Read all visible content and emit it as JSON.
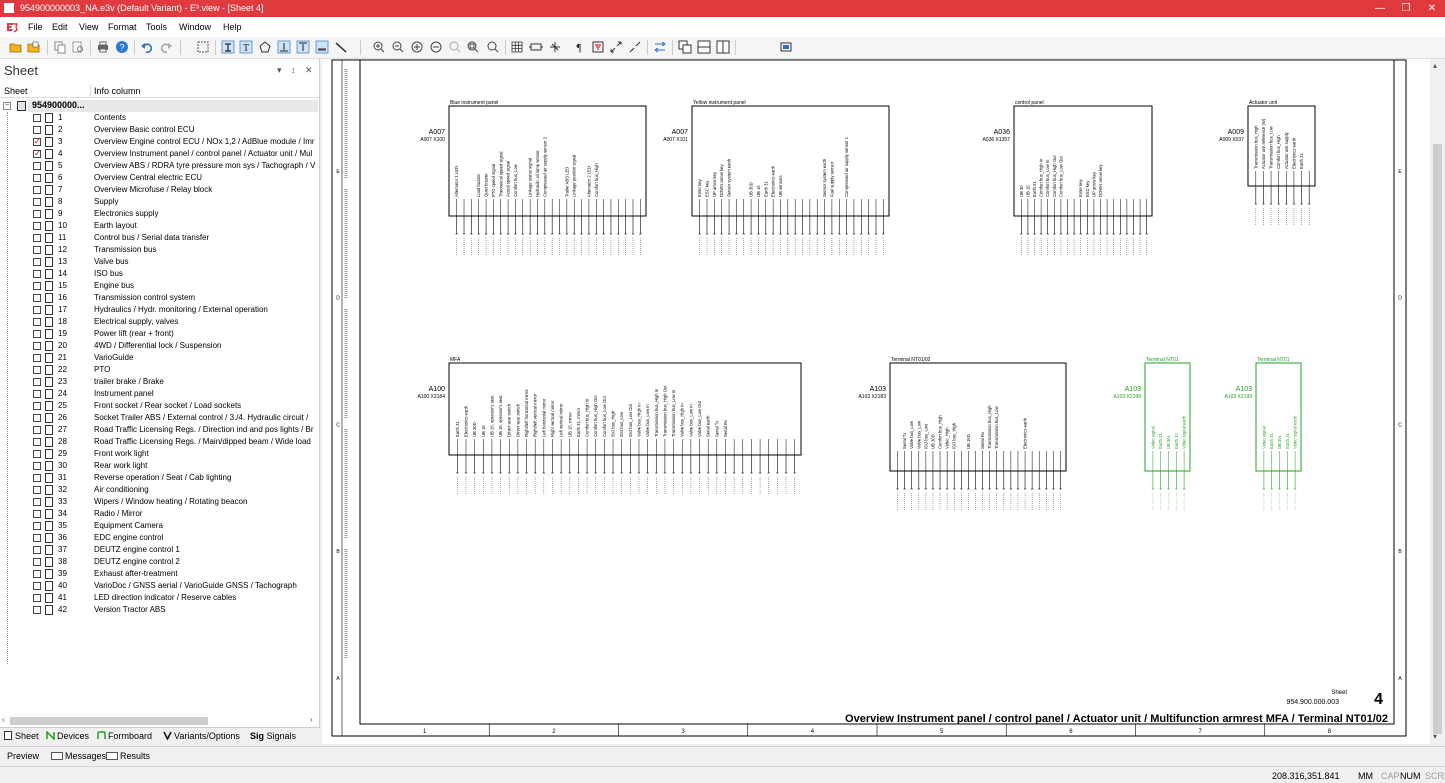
{
  "window": {
    "title": "954900000003_NA.e3v (Default Variant) - E³.view - [Sheet 4]",
    "min_icon": "minimize-icon",
    "max_icon": "restore-icon",
    "close_icon": "close-icon",
    "minimize_glyph": "—",
    "restore_glyph": "❐",
    "close_glyph": "✕"
  },
  "menu": [
    "File",
    "Edit",
    "View",
    "Format",
    "Tools",
    "Window",
    "Help"
  ],
  "sidebar": {
    "panel_title": "Sheet",
    "panel_dropdown_glyph": "▾",
    "panel_pin_glyph": "↕",
    "panel_close_glyph": "✕",
    "col_sheet": "Sheet",
    "col_info": "Info column",
    "root_label": "954900000...",
    "expand_glyph": "−",
    "scroll_left_glyph": "‹",
    "scroll_right_glyph": "›",
    "sheets": [
      {
        "num": "1",
        "info": "Contents",
        "checked": false
      },
      {
        "num": "2",
        "info": "Overview Basic control ECU",
        "checked": false
      },
      {
        "num": "3",
        "info": "Overview Engine control ECU / NOx 1,2 / AdBlue module / Imr",
        "checked": true
      },
      {
        "num": "4",
        "info": "Overview Instrument panel / control panel / Actuator unit / Mul",
        "checked": true
      },
      {
        "num": "5",
        "info": "Overview ABS / RDRA tyre pressure mon sys / Tachograph / V",
        "checked": false
      },
      {
        "num": "6",
        "info": "Overview Central electric ECU",
        "checked": false
      },
      {
        "num": "7",
        "info": "Overview Microfuse / Relay block",
        "checked": false
      },
      {
        "num": "8",
        "info": "Supply",
        "checked": false
      },
      {
        "num": "9",
        "info": "Electronics supply",
        "checked": false
      },
      {
        "num": "10",
        "info": "Earth layout",
        "checked": false
      },
      {
        "num": "11",
        "info": "Control bus / Serial data transfer",
        "checked": false
      },
      {
        "num": "12",
        "info": "Transmission bus",
        "checked": false
      },
      {
        "num": "13",
        "info": "Valve bus",
        "checked": false
      },
      {
        "num": "14",
        "info": "ISO bus",
        "checked": false
      },
      {
        "num": "15",
        "info": "Engine bus",
        "checked": false
      },
      {
        "num": "16",
        "info": "Transmission control system",
        "checked": false
      },
      {
        "num": "17",
        "info": "Hydraulics / Hydr. monitoring / External operation",
        "checked": false
      },
      {
        "num": "18",
        "info": "Electrical supply, valves",
        "checked": false
      },
      {
        "num": "19",
        "info": "Power lift (rear + front)",
        "checked": false
      },
      {
        "num": "20",
        "info": "4WD / Differential lock / Suspension",
        "checked": false
      },
      {
        "num": "21",
        "info": "VarioGuide",
        "checked": false
      },
      {
        "num": "22",
        "info": "PTO",
        "checked": false
      },
      {
        "num": "23",
        "info": "trailer brake / Brake",
        "checked": false
      },
      {
        "num": "24",
        "info": "Instrument panel",
        "checked": false
      },
      {
        "num": "25",
        "info": "Front socket / Rear socket / Load sockets",
        "checked": false
      },
      {
        "num": "26",
        "info": "Socket Trailer ABS / External control / 3./4. Hydraulic circuit /",
        "checked": false
      },
      {
        "num": "27",
        "info": "Road Traffic Licensing Regs. / Direction ind and pos lights / Br",
        "checked": false
      },
      {
        "num": "28",
        "info": "Road Traffic Licensing Regs. / Main/dipped beam / Wide load",
        "checked": false
      },
      {
        "num": "29",
        "info": "Front work light",
        "checked": false
      },
      {
        "num": "30",
        "info": "Rear work light",
        "checked": false
      },
      {
        "num": "31",
        "info": "Reverse operation / Seat / Cab lighting",
        "checked": false
      },
      {
        "num": "32",
        "info": "Air conditioning",
        "checked": false
      },
      {
        "num": "33",
        "info": "Wipers / Window heating / Rotating beacon",
        "checked": false
      },
      {
        "num": "34",
        "info": "Radio / Mirror",
        "checked": false
      },
      {
        "num": "35",
        "info": "Equipment Camera",
        "checked": false
      },
      {
        "num": "36",
        "info": "EDC engine control",
        "checked": false
      },
      {
        "num": "37",
        "info": "DEUTZ engine control 1",
        "checked": false
      },
      {
        "num": "38",
        "info": "DEUTZ engine control 2",
        "checked": false
      },
      {
        "num": "39",
        "info": "Exhaust after-treatment",
        "checked": false
      },
      {
        "num": "40",
        "info": "VarioDoc / GNSS aerial / VarioGuide GNSS / Tachograph",
        "checked": false
      },
      {
        "num": "41",
        "info": "LED direction indicator / Reserve cables",
        "checked": false
      },
      {
        "num": "42",
        "info": "Version Tractor ABS",
        "checked": false
      }
    ]
  },
  "bottom_tabs": [
    "Sheet",
    "Devices",
    "Formboard",
    "Variants/Options",
    "Signals"
  ],
  "bottom_tab_icon_text": "Sig",
  "output_tabs": [
    "Preview",
    "Messages",
    "Results"
  ],
  "status": {
    "coords": "208.316,351.841",
    "units": "MM",
    "caps": "CAP",
    "num": "NUM",
    "scrl": "SCRL"
  },
  "colors": {
    "title_red": "#e03a3e",
    "green": "#20a020"
  },
  "drawing": {
    "sheet_title": "Overview Instrument panel / control panel / Actuator unit / Multifunction armrest MFA / Terminal NT01/02",
    "sheet_label": "Sheet",
    "sheet_number_code": "954.900.000.003",
    "sheet_number": "4",
    "columns": [
      "1",
      "2",
      "3",
      "4",
      "5",
      "6",
      "7",
      "8"
    ],
    "rows_left": [
      "E",
      "D",
      "C",
      "B",
      "A"
    ],
    "rows_right": [
      "E",
      "D",
      "C",
      "B",
      "A"
    ],
    "vscroll_up_glyph": "▴",
    "vscroll_down_glyph": "▾",
    "components": [
      {
        "id": "A007",
        "ref": "A007  X100",
        "title": "Blue instrument panel",
        "pins": 26,
        "color": "black",
        "signals": [
          "Alternator 1 LED",
          "",
          "",
          "Load buzzer",
          "Quiet buzzer",
          "PTO speed signal",
          "Theoretical speed signal",
          "Actual speed signal",
          "Comfort bus_Low",
          "",
          "Linkage status signal",
          "Hydraulic oil lamp sensor",
          "Compressed air supply sensor 2",
          "",
          "",
          "Trailer ABS LED",
          "Linkage position signal",
          "",
          "Alternator 2 LED",
          "Comfort bus_High"
        ]
      },
      {
        "id": "A007",
        "ref": "A007  X101",
        "title": "Yellow instrument panel",
        "pins": 26,
        "color": "black",
        "signals": [
          "Enter key",
          "ESC key",
          "UP arrow key",
          "DOWN arrow key",
          "Sensor system earth",
          "",
          "",
          "UB 30D",
          "UB 15",
          "Earth 31",
          "Electronics earth",
          "UB sensors",
          "",
          "",
          "",
          "",
          "",
          "Sensor system earth",
          "Fuel supply sensor",
          "",
          "Compressed air supply sensor 1"
        ]
      },
      {
        "id": "A036",
        "ref": "A036  X1357",
        "title": "control panel",
        "pins": 20,
        "color": "black",
        "signals": [
          "UB 30",
          "UB 15",
          "Earth 31",
          "Comfort bus_High In",
          "Comfort bus_Low In",
          "Comfort bus_High Out",
          "Comfort bus_Low Out",
          "",
          "",
          "Enter key",
          "ESC key",
          "UP arrow key",
          "DOWN arrow key"
        ]
      },
      {
        "id": "A009",
        "ref": "A009  X037",
        "title": "Actuator unit",
        "pins": 8,
        "color": "black",
        "signals": [
          "Transmission bus_High",
          "Actuator unit reference (W)",
          "Transmission bus_Low",
          "Comfort bus_High",
          "Actuator unit supply",
          "Electronics earth",
          "Earth 31"
        ]
      },
      {
        "id": "A100",
        "ref": "A100  X2184",
        "title": "MFA",
        "pins": 40,
        "color": "black",
        "signals": [
          "Earth 31",
          "Electronics earth",
          "UB 30D",
          "UB 15",
          "UB 15, operator's seat",
          "UB 15, operator's seat",
          "Driver seat switch",
          "Driver seat switch",
          "Right/left horizontal mirror",
          "Right/left vertical mirror",
          "Left horizontal mirror",
          "Right vertical mirror",
          "Left vertical mirror",
          "UB 15, mirror",
          "Earth 31, mirror",
          "Comfort bus_High In",
          "Comfort bus_High Out",
          "Comfort bus_Low Out",
          "ISO bus_High",
          "ISO bus_Low",
          "ISO bus_Low Out",
          "Valve bus_High In",
          "Valve bus_Low In",
          "Transmission bus_High In",
          "Transmission bus_High Out",
          "Transmission bus_Low In",
          "Valve bus_High In",
          "Valve bus_Low In",
          "Valve bus_Low Out",
          "Serial earth",
          "Serial Tx",
          "Serial Rx"
        ]
      },
      {
        "id": "A103",
        "ref": "A103  X2183",
        "title": "Terminal NT01/02",
        "pins": 24,
        "color": "black",
        "signals": [
          "",
          "Serial Tx",
          "Valve bus_Low",
          "Valve bus_Low",
          "ISO bus_Low",
          "UB 30D",
          "Comfort bus_High",
          "Video_High",
          "ISO bus_High",
          "",
          "UB 15D",
          "",
          "Serial Rx",
          "Transmission bus_High",
          "Transmission bus_Low",
          "",
          "",
          "",
          "Electronics earth"
        ]
      },
      {
        "id": "A103",
        "ref": "A103  X2198",
        "title": "Terminal NT01",
        "pins": 5,
        "color": "green",
        "signals": [
          "Video signal",
          "Earth 31",
          "UB 30L",
          "Earth 31",
          "Video signal earth"
        ]
      },
      {
        "id": "A103",
        "ref": "A103  X2199",
        "title": "Terminal NT01",
        "pins": 5,
        "color": "green",
        "signals": [
          "Video signal",
          "Earth 31",
          "UB 30L",
          "Earth 31",
          "Video signal earth"
        ]
      }
    ]
  }
}
